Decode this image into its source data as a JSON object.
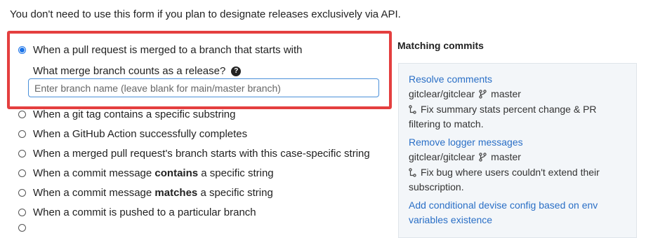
{
  "intro_text": "You don't need to use this form if you plan to designate releases exclusively via API.",
  "options": {
    "selected": {
      "label": "When a pull request is merged to a branch that starts with",
      "sub_label": "What merge branch counts as a release?",
      "input_placeholder": "Enter branch name (leave blank for main/master branch)"
    },
    "git_tag": "When a git tag contains a specific substring",
    "action": "When a GitHub Action successfully completes",
    "merged_branch": "When a merged pull request's branch starts with this case-specific string",
    "contains": {
      "before": "When a commit message ",
      "bold": "contains",
      "after": " a specific string"
    },
    "matches": {
      "before": "When a commit message ",
      "bold": "matches",
      "after": " a specific string"
    },
    "pushed": "When a commit is pushed to a particular branch"
  },
  "matching_commits": {
    "title": "Matching commits",
    "commits": [
      {
        "title": "Resolve comments",
        "repo": "gitclear/gitclear",
        "branch": "master",
        "message_line1": "Fix summary stats percent change & PR",
        "message_line2": "filtering to match."
      },
      {
        "title": "Remove logger messages",
        "repo": "gitclear/gitclear",
        "branch": "master",
        "message_line1": "Fix bug where users couldn't extend their",
        "message_line2": "subscription."
      },
      {
        "title_line1": "Add conditional devise config based on env",
        "title_line2": "variables existence"
      }
    ]
  },
  "colors": {
    "accent": "#1a73e8",
    "highlight": "#e43f3f",
    "link": "#2a6fc6",
    "panel_bg": "#f3f6f9"
  }
}
